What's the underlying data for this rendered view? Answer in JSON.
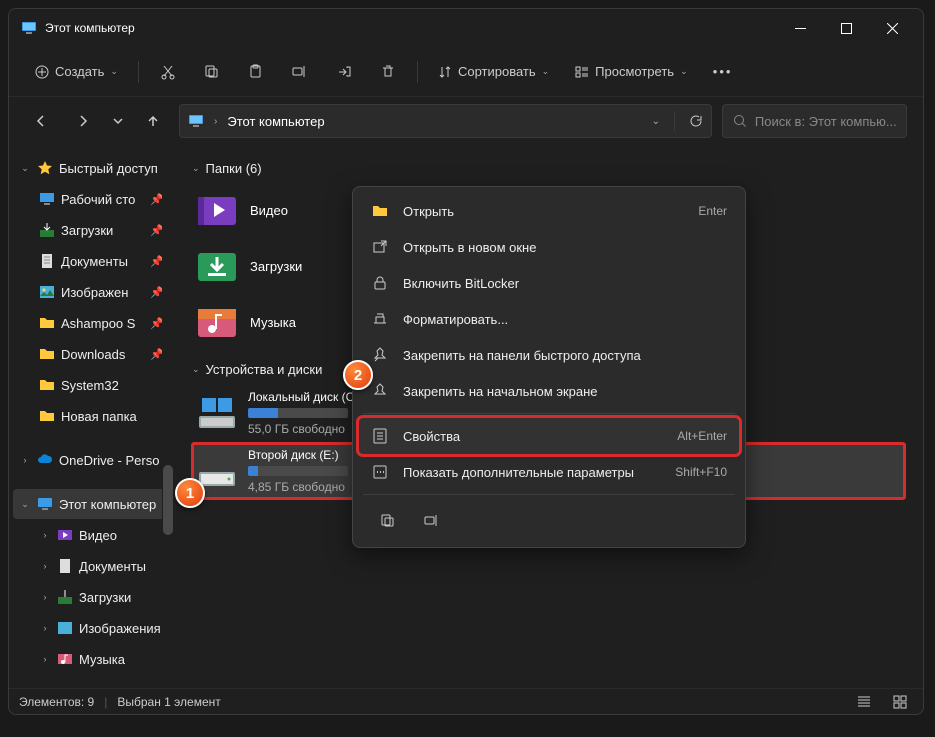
{
  "window": {
    "title": "Этот компьютер"
  },
  "toolbar": {
    "create": "Создать",
    "sort": "Сортировать",
    "view": "Просмотреть"
  },
  "nav": {
    "breadcrumb": "Этот компьютер"
  },
  "search": {
    "placeholder": "Поиск в: Этот компью..."
  },
  "sidebar": {
    "quick": "Быстрый доступ",
    "items": [
      {
        "label": "Рабочий сто",
        "pin": true
      },
      {
        "label": "Загрузки",
        "pin": true
      },
      {
        "label": "Документы",
        "pin": true
      },
      {
        "label": "Изображен",
        "pin": true
      },
      {
        "label": "Ashampoo S",
        "pin": true
      },
      {
        "label": "Downloads",
        "pin": true
      },
      {
        "label": "System32",
        "pin": false
      },
      {
        "label": "Новая папка",
        "pin": false
      }
    ],
    "onedrive": "OneDrive - Perso",
    "thispc": "Этот компьютер",
    "pc_items": [
      {
        "label": "Видео"
      },
      {
        "label": "Документы"
      },
      {
        "label": "Загрузки"
      },
      {
        "label": "Изображения"
      },
      {
        "label": "Музыка"
      }
    ]
  },
  "content": {
    "folders_header": "Папки (6)",
    "folders": [
      {
        "label": "Видео"
      },
      {
        "label": "Загрузки"
      },
      {
        "label": "Музыка"
      }
    ],
    "drives_header": "Устройства и диски",
    "drives": [
      {
        "name": "Локальный диск (С",
        "free": "55,0 ГБ свободно",
        "fill": 30
      },
      {
        "name": "Второй диск (E:)",
        "free": "4,85 ГБ свободно",
        "fill": 10
      }
    ]
  },
  "context_menu": {
    "items": [
      {
        "label": "Открыть",
        "shortcut": "Enter",
        "icon": "folder"
      },
      {
        "label": "Открыть в новом окне",
        "icon": "new-window"
      },
      {
        "label": "Включить BitLocker",
        "icon": "lock"
      },
      {
        "label": "Форматировать...",
        "icon": "format"
      },
      {
        "label": "Закрепить на панели быстрого доступа",
        "icon": "pin"
      },
      {
        "label": "Закрепить на начальном экране",
        "icon": "pin-start"
      },
      {
        "label": "Свойства",
        "shortcut": "Alt+Enter",
        "icon": "properties",
        "highlight": true
      },
      {
        "label": "Показать дополнительные параметры",
        "shortcut": "Shift+F10",
        "icon": "more"
      }
    ]
  },
  "status": {
    "count": "Элементов: 9",
    "selected": "Выбран 1 элемент"
  },
  "badges": {
    "b1": "1",
    "b2": "2"
  }
}
